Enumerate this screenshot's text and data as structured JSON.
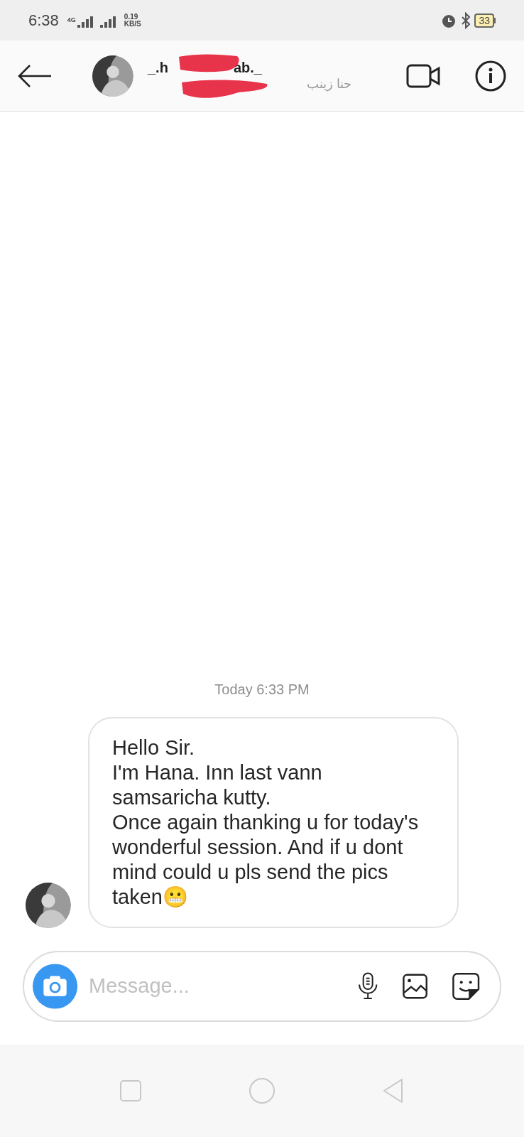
{
  "status_bar": {
    "time": "6:38",
    "network": "4G",
    "speed_value": "0.19",
    "speed_unit": "KB/S",
    "battery": "33"
  },
  "header": {
    "username_parts": [
      "_.h",
      "ab._"
    ],
    "redacted": true,
    "arabic_name": "حنا زينب"
  },
  "messages": [
    {
      "kind": "timestamp",
      "text": "Today 6:33 PM"
    },
    {
      "kind": "received",
      "text": "Hello Sir.\nI'm Hana. Inn last vann samsaricha kutty.\nOnce again thanking u for today's wonderful session. And if u dont mind could u pls send the pics taken😬"
    }
  ],
  "composer": {
    "placeholder": "Message..."
  }
}
